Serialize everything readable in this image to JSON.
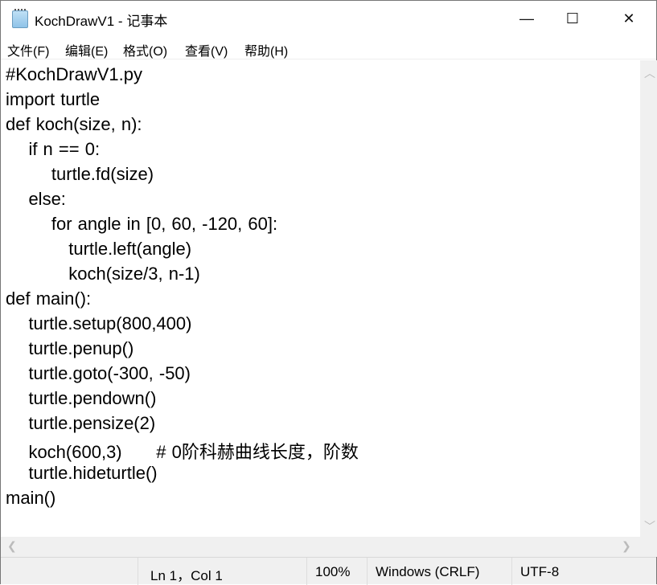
{
  "window": {
    "title": "KochDrawV1 - 记事本",
    "minimize": "—",
    "maximize": "☐",
    "close": "✕"
  },
  "menu": [
    "文件(F)",
    "编辑(E)",
    "格式(O)",
    "查看(V)",
    "帮助(H)"
  ],
  "lines": [
    "#KochDrawV1.py",
    "import turtle",
    "def koch(size, n):",
    "    if n == 0:",
    "        turtle.fd(size)",
    "    else:",
    "        for angle in [0, 60, -120, 60]:",
    "           turtle.left(angle)",
    "           koch(size/3, n-1)",
    "def main():",
    "    turtle.setup(800,400)",
    "    turtle.penup()",
    "    turtle.goto(-300, -50)",
    "    turtle.pendown()",
    "    turtle.pensize(2)",
    "    koch(600,3)      # 0阶科赫曲线长度，阶数",
    "    turtle.hideturtle()",
    "main()"
  ],
  "status": {
    "position": "Ln 1，Col 1",
    "zoom": "100%",
    "line_ending": "Windows (CRLF)",
    "encoding": "UTF-8"
  }
}
